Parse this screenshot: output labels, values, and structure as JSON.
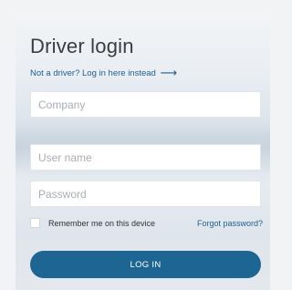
{
  "login": {
    "title": "Driver login",
    "not_driver_link": "Not a driver? Log in here instead",
    "not_driver_arrow": "⟶",
    "company_placeholder": "Company",
    "username_placeholder": "User name",
    "password_placeholder": "Password",
    "remember_label": "Remember me on this device",
    "forgot_link": "Forgot password?",
    "login_button": "LOG IN"
  },
  "colors": {
    "accent": "#1d6592",
    "link": "#1e5f8f"
  },
  "icons": {
    "arrow": "arrow-right-icon"
  }
}
